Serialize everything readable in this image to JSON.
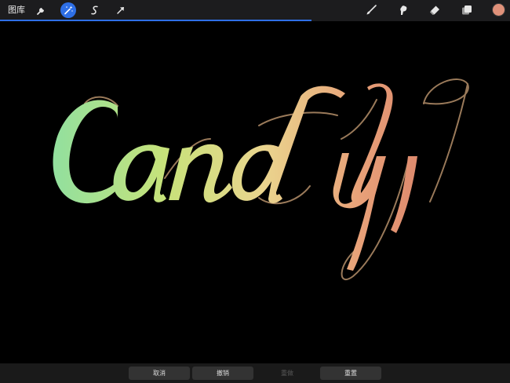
{
  "topbar": {
    "gallery_label": "图库",
    "tools_left": [
      {
        "icon": "wrench-icon",
        "active": false
      },
      {
        "icon": "magic-wand-icon",
        "active": true
      },
      {
        "icon": "s-curve-icon",
        "active": false
      },
      {
        "icon": "arrow-cursor-icon",
        "active": false
      }
    ],
    "tools_right": [
      {
        "icon": "brush-icon"
      },
      {
        "icon": "smudge-icon"
      },
      {
        "icon": "eraser-icon"
      },
      {
        "icon": "layers-icon"
      }
    ],
    "current_color": "#e0917a",
    "accent_color": "#2e6fe6",
    "progress_fraction": 0.61
  },
  "canvas": {
    "artwork_text": "Candy",
    "gradient": [
      "#8fe0a0",
      "#c7e27a",
      "#ead58e",
      "#e8a078",
      "#d9826a"
    ],
    "flourish_color": "#9a7a5a"
  },
  "bottombar": {
    "cancel_label": "取消",
    "undo_label": "撤销",
    "redo_label": "重做",
    "reset_label": "重置"
  }
}
